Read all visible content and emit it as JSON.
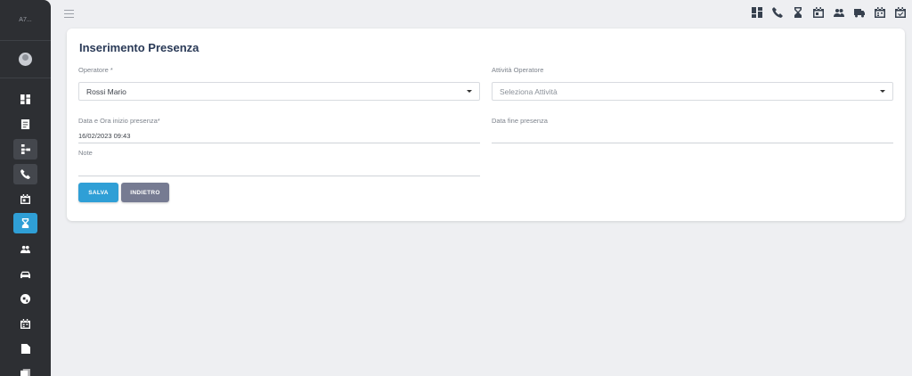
{
  "sidebar": {
    "logo_text": "A7...",
    "items": [
      {
        "icon": "dashboard-icon"
      },
      {
        "icon": "document-icon"
      },
      {
        "icon": "hierarchy-icon"
      },
      {
        "icon": "phone-icon"
      },
      {
        "icon": "calendar-icon"
      },
      {
        "icon": "hourglass-icon"
      },
      {
        "icon": "people-icon"
      },
      {
        "icon": "car-icon"
      },
      {
        "icon": "globe-icon"
      },
      {
        "icon": "calendar-grid-icon"
      },
      {
        "icon": "file-icon"
      },
      {
        "icon": "copy-icon"
      }
    ]
  },
  "topbar": {
    "icons": [
      "dashboard-icon",
      "phone-icon",
      "hourglass-icon",
      "calendar-icon",
      "people-icon",
      "truck-icon",
      "calendar-grid-icon",
      "calendar-check-icon"
    ]
  },
  "form": {
    "title": "Inserimento Presenza",
    "operatore_label": "Operatore *",
    "operatore_value": "Rossi Mario",
    "attivita_label": "Attività Operatore",
    "attivita_placeholder": "Seleziona Attività",
    "data_inizio_label": "Data e Ora inizio presenza*",
    "data_inizio_value": "16/02/2023 09:43",
    "data_fine_label": "Data fine presenza",
    "data_fine_value": "",
    "note_label": "Note",
    "note_value": "",
    "save_label": "SALVA",
    "back_label": "INDIETRO"
  },
  "colors": {
    "accent": "#2f9fd6",
    "sidebar_bg": "#2d2f33",
    "secondary_button": "#767b92",
    "title": "#2a3a57"
  }
}
